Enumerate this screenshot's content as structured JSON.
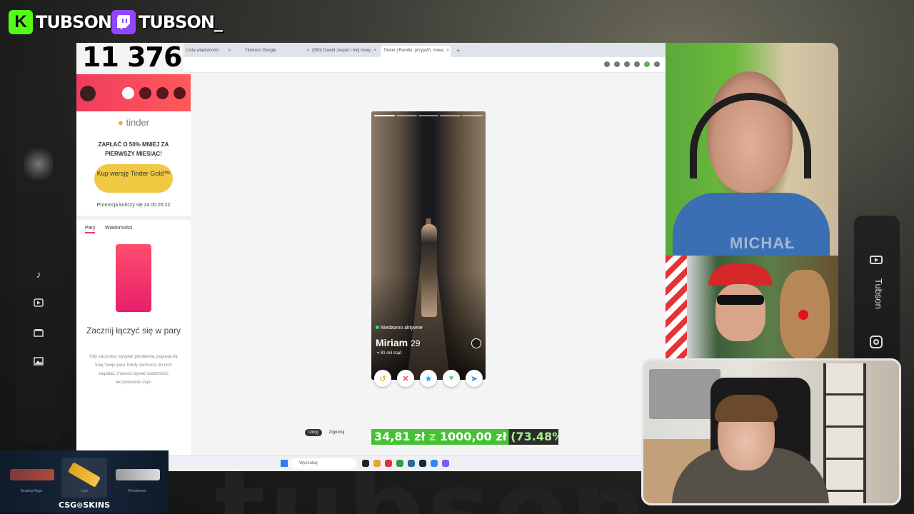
{
  "socials": {
    "kick": {
      "logo": "K",
      "name": "TUBSON"
    },
    "twitch": {
      "name": "TUBSON_"
    }
  },
  "watermark": "tubson",
  "right_bar": {
    "name": "Tubson"
  },
  "counter": "11 376",
  "browser": {
    "tabs": [
      {
        "label": "Lista wiadomości"
      },
      {
        "label": "Tłumacz Google"
      },
      {
        "label": "(550) Dawid Jasper i mój nowy..."
      },
      {
        "label": "Tinder | Randki, przyjaźń, nowe..."
      }
    ],
    "new_tab": "+"
  },
  "tinder": {
    "logo": "tinder",
    "promo": "ZAPŁAĆ O 50% MNIEJ ZA PIERWSZY MIESIĄC!",
    "gold_button": "Kup wersję Tinder Gold™",
    "timer": "Promocja kończy się za 00:26:22",
    "tabs": [
      "Pary",
      "Wiadomości"
    ],
    "empty_title": "Zacznij łączyć się w pary",
    "empty_desc": "Gdy zaczniesz wysyłać polubienia, pojawią się tutaj Twoje pary. Kiedy zechcesz do nich zagadać, możesz wysłać wiadomość bezpośrednio stąd.",
    "profile": {
      "status": "Niedawno aktywne",
      "name": "Miriam",
      "age": "29",
      "distance": "81 mil stąd"
    },
    "hints": {
      "hide": "Ukryj",
      "nope": "Zignoruj"
    }
  },
  "taskbar": {
    "search_placeholder": "Wyszukaj"
  },
  "donation": {
    "current": "34,81 zł",
    "separator": "z",
    "goal": "1000,00 zł",
    "percent": "(73.48%",
    "progress": 0.7348
  },
  "webcam": {
    "tag": "MICHAŁ"
  },
  "skins_banner": {
    "brand": "CSG⊙SKINS",
    "items": [
      "Searing Rage",
      "Lore",
      "Printstream"
    ]
  },
  "colors": {
    "kick": "#53fc18",
    "twitch": "#9146ff",
    "tinder_gradient_start": "#f03c5f",
    "tinder_gold": "#f1c842",
    "donation_bar": "#45c234"
  }
}
